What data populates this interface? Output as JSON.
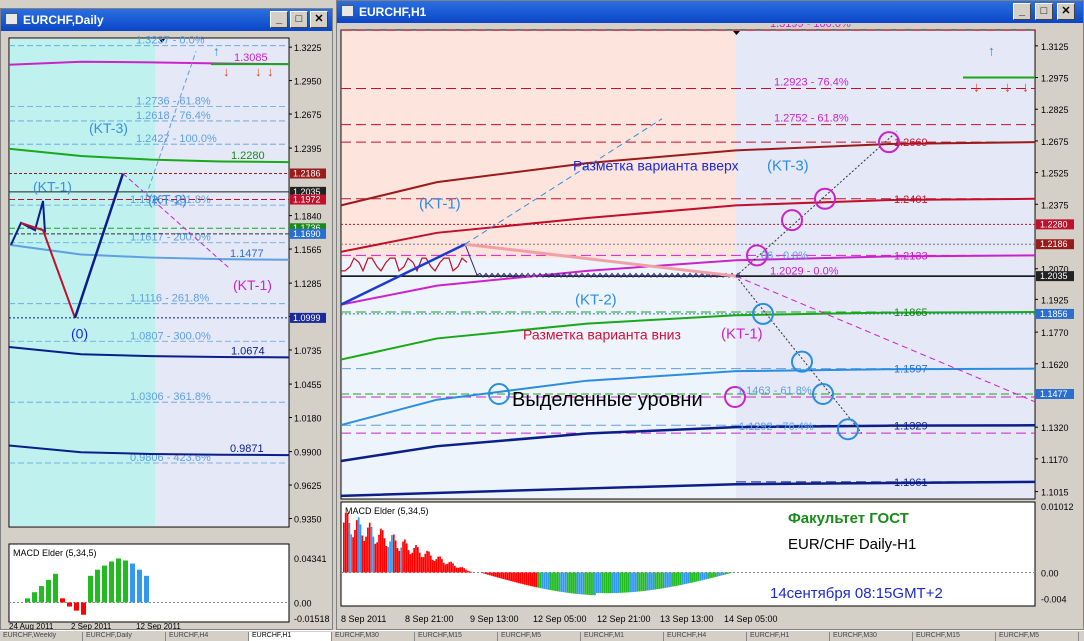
{
  "colors": {
    "cyan_zone": "#bff2ef",
    "lavender_zone": "#e4e8f7",
    "salmon_zone": "#fde4dc",
    "pale_blue_zone": "#eef4fb",
    "fib_magenta": "#cc22cc",
    "fib_blue": "#5fa0e0",
    "fib_red": "#c0102c",
    "dark_red": "#9a1b1b",
    "green": "#1aa81a",
    "navy": "#0b1e8a",
    "blue_label": "#3a8de0"
  },
  "window_daily": {
    "title": "EURCHF,Daily",
    "buttons": [
      "minimize-button",
      "maximize-button",
      "close-button"
    ],
    "y_ticks": [
      {
        "label": "1.3225",
        "price": 1.3225
      },
      {
        "label": "1.2950",
        "price": 1.295
      },
      {
        "label": "1.2675",
        "price": 1.2675
      },
      {
        "label": "1.2395",
        "price": 1.2395
      },
      {
        "label": "1.1840",
        "price": 1.184
      },
      {
        "label": "1.1565",
        "price": 1.1565
      },
      {
        "label": "1.1285",
        "price": 1.1285
      },
      {
        "label": "1.1010",
        "price": 1.101
      },
      {
        "label": "1.0735",
        "price": 1.0735
      },
      {
        "label": "1.0455",
        "price": 1.0455
      },
      {
        "label": "1.0180",
        "price": 1.018
      },
      {
        "label": "0.9900",
        "price": 0.99
      },
      {
        "label": "0.9625",
        "price": 0.9625
      },
      {
        "label": "0.9350",
        "price": 0.935
      }
    ],
    "price_tags": [
      {
        "label": "1.2186",
        "price": 1.2186,
        "bg": "#9a1b1b"
      },
      {
        "label": "1.2035",
        "price": 1.2035,
        "bg": "#222222"
      },
      {
        "label": "1.1972",
        "price": 1.1972,
        "bg": "#c0102c"
      },
      {
        "label": "1.1736",
        "price": 1.1736,
        "bg": "#1a8a1a"
      },
      {
        "label": "1.1690",
        "price": 1.169,
        "bg": "#2a6fd0"
      },
      {
        "label": "1.0999",
        "price": 1.0999,
        "bg": "#1a2a9a"
      }
    ],
    "fib_labels": [
      {
        "text": "1.3237 - 0.0%",
        "price": 1.3237
      },
      {
        "text": "1.2736 - 61.8%",
        "price": 1.2736
      },
      {
        "text": "1.2618 - 76.4%",
        "price": 1.2618
      },
      {
        "text": "1.2427 - 100.0%",
        "price": 1.2427
      },
      {
        "text": "1.1926 - 161.8%",
        "price": 1.1926
      },
      {
        "text": "1.1617 - 200.0%",
        "price": 1.1617
      },
      {
        "text": "1.1116 - 261.8%",
        "price": 1.1116
      },
      {
        "text": "1.0807 - 300.0%",
        "price": 1.0807
      },
      {
        "text": "1.0306 - 361.8%",
        "price": 1.0306
      },
      {
        "text": "0.9806 - 423.6%",
        "price": 0.9806
      }
    ],
    "value_labels": [
      {
        "text": "1.3085",
        "price": 1.3085,
        "color": "#cc22cc"
      },
      {
        "text": "1.2280",
        "price": 1.228,
        "color": "#1a8a1a"
      },
      {
        "text": "1.1477",
        "price": 1.1477,
        "color": "#2a6fd0"
      },
      {
        "text": "1.0674",
        "price": 1.0674,
        "color": "#0b1e8a"
      },
      {
        "text": "0.9871",
        "price": 0.9871,
        "color": "#0b1e8a"
      }
    ],
    "wave_labels": [
      {
        "text": "(KT-3)",
        "color": "#3a8de0"
      },
      {
        "text": "(KT-1)",
        "color": "#3a8de0"
      },
      {
        "text": "(KT-2)",
        "color": "#3a8de0"
      },
      {
        "text": "(KT-1)",
        "color": "#cc22cc"
      },
      {
        "text": "(0)",
        "color": "#1a2ad0"
      }
    ],
    "macd": {
      "title": "MACD Elder (5,34,5)",
      "ticks": [
        "0.04341",
        "0.00",
        "-0.01518"
      ],
      "bars": [
        0.004,
        0.01,
        0.016,
        0.022,
        0.028,
        0.004,
        -0.004,
        -0.008,
        -0.012,
        0.026,
        0.032,
        0.036,
        0.04,
        0.043,
        0.041,
        0.038,
        0.032,
        0.026
      ],
      "colors": [
        "g",
        "g",
        "g",
        "g",
        "g",
        "r",
        "r",
        "r",
        "r",
        "g",
        "g",
        "g",
        "g",
        "g",
        "g",
        "b",
        "b",
        "b"
      ]
    },
    "x_labels": [
      "24 Aug 2011",
      "2 Sep 2011",
      "12 Sep 2011"
    ]
  },
  "window_h1": {
    "title": "EURCHF,H1",
    "buttons": [
      "minimize-button",
      "maximize-button",
      "close-button"
    ],
    "y_ticks": [
      {
        "label": "1.3125",
        "price": 1.3125
      },
      {
        "label": "1.2975",
        "price": 1.2975
      },
      {
        "label": "1.2825",
        "price": 1.2825
      },
      {
        "label": "1.2675",
        "price": 1.2675
      },
      {
        "label": "1.2525",
        "price": 1.2525
      },
      {
        "label": "1.2375",
        "price": 1.2375
      },
      {
        "label": "1.2070",
        "price": 1.207
      },
      {
        "label": "1.1925",
        "price": 1.1925
      },
      {
        "label": "1.1770",
        "price": 1.177
      },
      {
        "label": "1.1620",
        "price": 1.162
      },
      {
        "label": "1.1320",
        "price": 1.132
      },
      {
        "label": "1.1170",
        "price": 1.117
      },
      {
        "label": "1.1015",
        "price": 1.1015
      }
    ],
    "price_tags": [
      {
        "label": "1.2280",
        "price": 1.228,
        "bg": "#c0102c"
      },
      {
        "label": "1.2186",
        "price": 1.2186,
        "bg": "#9a1b1b"
      },
      {
        "label": "1.2035",
        "price": 1.2035,
        "bg": "#222222"
      },
      {
        "label": "1.1856",
        "price": 1.1856,
        "bg": "#2a6fd0"
      },
      {
        "label": "1.1477",
        "price": 1.1477,
        "bg": "#2a6fd0"
      }
    ],
    "fib_labels": [
      {
        "text": "1.3199 - 100.0%",
        "price": 1.3199
      },
      {
        "text": "1.2923 - 76.4%",
        "price": 1.2923
      },
      {
        "text": "1.2752 - 61.8%",
        "price": 1.2752
      },
      {
        "text": "1.2029 - 0.0%",
        "price": 1.2029
      },
      {
        "text": "1.1463 - 61.8%",
        "price": 1.1463
      },
      {
        "text": "1.1292 - 76.4%",
        "price": 1.1292
      }
    ],
    "value_labels": [
      {
        "text": "1.2669",
        "price": 1.2669,
        "color": "#c0102c"
      },
      {
        "text": "1.2401",
        "price": 1.2401,
        "color": "#c0102c"
      },
      {
        "text": "1.2133",
        "price": 1.2133,
        "color": "#cc22cc"
      },
      {
        "text": "1.1865",
        "price": 1.1865,
        "color": "#1a8a1a"
      },
      {
        "text": "1.1597",
        "price": 1.1597,
        "color": "#2a6fd0"
      },
      {
        "text": "1.1329",
        "price": 1.1329,
        "color": "#0b1e8a"
      },
      {
        "text": "1.1061",
        "price": 1.1061,
        "color": "#0b1e8a"
      }
    ],
    "partial_label": "06 - 0.0%",
    "annotations": {
      "up_variant": "Разметка варианта вверх",
      "kt3": "(KT-3)",
      "kt1_top": "(KT-1)",
      "kt2": "(KT-2)",
      "down_variant": "Разметка варианта вниз",
      "kt1_down": "(KT-1)",
      "highlighted_levels": "Выделенные уровни"
    },
    "macd": {
      "title": "MACD Elder (5,34,5)",
      "ticks": [
        "0.01012",
        "0.00",
        "-0.004"
      ]
    },
    "footer": {
      "faculty": "Факультет ГОСТ",
      "pair": "EUR/CHF Daily-H1",
      "datetime": "14сентября 08:15GMT+2"
    },
    "x_labels": [
      "8 Sep 2011",
      "8 Sep 21:00",
      "9 Sep 13:00",
      "12 Sep 05:00",
      "12 Sep 21:00",
      "13 Sep 13:00",
      "14 Sep 05:00"
    ]
  },
  "chart_data": [
    {
      "type": "line",
      "title": "EURCHF,Daily",
      "ylim": [
        0.928,
        1.33
      ],
      "levels": [
        1.3237,
        1.2736,
        1.2618,
        1.2427,
        1.1926,
        1.1617,
        1.1116,
        1.0807,
        1.0306,
        0.9806
      ]
    },
    {
      "type": "line",
      "title": "EURCHF,H1",
      "ylim": [
        1.098,
        1.32
      ],
      "levels": [
        1.3199,
        1.2923,
        1.2752,
        1.2029,
        1.1463,
        1.1292
      ]
    }
  ],
  "tabs": [
    "EURCHF,Weekly",
    "EURCHF,Daily",
    "EURCHF,H4",
    "EURCHF,H1",
    "EURCHF,M30",
    "EURCHF,M15",
    "EURCHF,M5",
    "EURCHF,M1",
    "EURCHF,H4",
    "EURCHF,H1",
    "EURCHF,M30",
    "EURCHF,M15",
    "EURCHF,M5"
  ]
}
